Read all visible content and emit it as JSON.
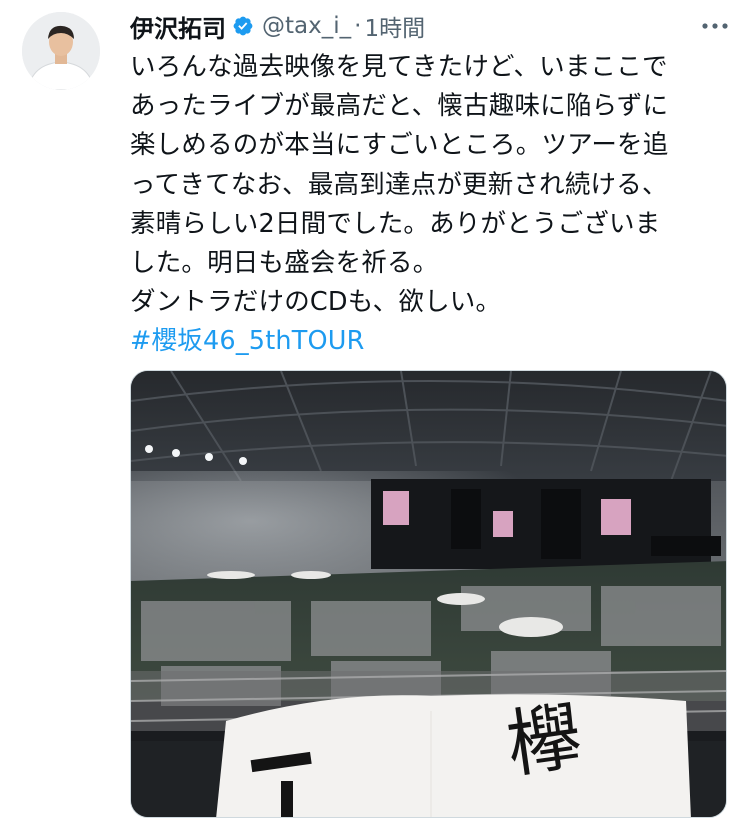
{
  "tweet": {
    "display_name": "伊沢拓司",
    "handle": "@tax_i_",
    "separator": "·",
    "time": "1時間",
    "text_lines": [
      "いろんな過去映像を見てきたけど、いまここで",
      "あったライブが最高だと、懐古趣味に陥らずに",
      "楽しめるのが本当にすごいところ。ツアーを追",
      "ってきてなお、最高到達点が更新され続ける、",
      "素晴らしい2日間でした。ありがとうございま",
      "した。明日も盛会を祈る。",
      "ダントラだけのCDも、欲しい。"
    ],
    "hashtag": "#櫻坂46_5thTOUR",
    "media": {
      "screen_text": "欅"
    }
  },
  "icons": {
    "verified": "verified-badge-icon",
    "more": "more-dots-icon"
  },
  "colors": {
    "accent": "#1d9bf0",
    "text": "#0f1419",
    "secondary": "#536471"
  }
}
